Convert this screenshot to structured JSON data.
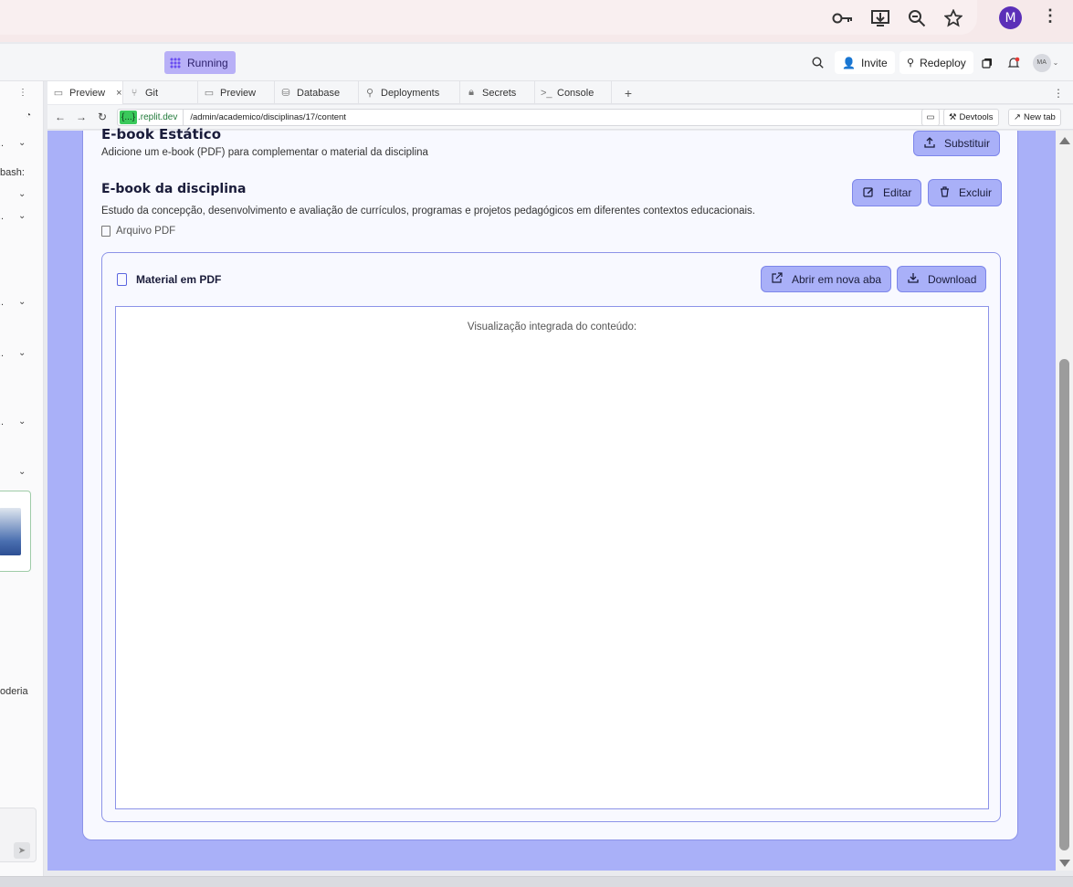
{
  "chrome": {
    "icons": [
      "key-icon",
      "install-app-icon",
      "zoom-icon",
      "bookmark-star-icon",
      "menu-dots-icon"
    ],
    "profile_initial": "M"
  },
  "replit": {
    "status": "Running",
    "invite_label": "Invite",
    "redeploy_label": "Redeploy",
    "user_avatar_initials": "MA"
  },
  "tabs": [
    {
      "label": "Preview",
      "icon": "monitor-icon",
      "active": true
    },
    {
      "label": "Git",
      "icon": "git-icon"
    },
    {
      "label": "Preview",
      "icon": "monitor-icon"
    },
    {
      "label": "Database",
      "icon": "database-icon"
    },
    {
      "label": "Deployments",
      "icon": "deploy-icon"
    },
    {
      "label": "Secrets",
      "icon": "lock-icon"
    },
    {
      "label": "Console",
      "icon": "console-icon"
    }
  ],
  "address": {
    "badge": "{...}",
    "domain": ".replit.dev",
    "path": "/admin/academico/disciplinas/17/content",
    "devtools_label": "Devtools",
    "newtab_label": "New tab"
  },
  "sidebar": {
    "snippets": [
      "bash:",
      "oderia"
    ]
  },
  "page": {
    "header_title": "E-book Estático",
    "header_subtitle": "Adicione um e-book (PDF) para complementar o material da disciplina",
    "replace_button": "Substituir",
    "ebook_title": "E-book da disciplina",
    "ebook_description": "Estudo da concepção, desenvolvimento e avaliação de currículos, programas e projetos pedagógicos em diferentes contextos educacionais.",
    "file_type": "Arquivo PDF",
    "edit_button": "Editar",
    "delete_button": "Excluir",
    "pdf_panel_title": "Material em PDF",
    "open_new_tab_button": "Abrir em nova aba",
    "download_button": "Download",
    "viewer_text": "Visualização integrada do conteúdo:"
  },
  "colors": {
    "accent": "#a9b0f8",
    "accent_border": "#7d86ea",
    "running_badge": "#b8b0f7",
    "card_bg": "#f8f9ff"
  }
}
